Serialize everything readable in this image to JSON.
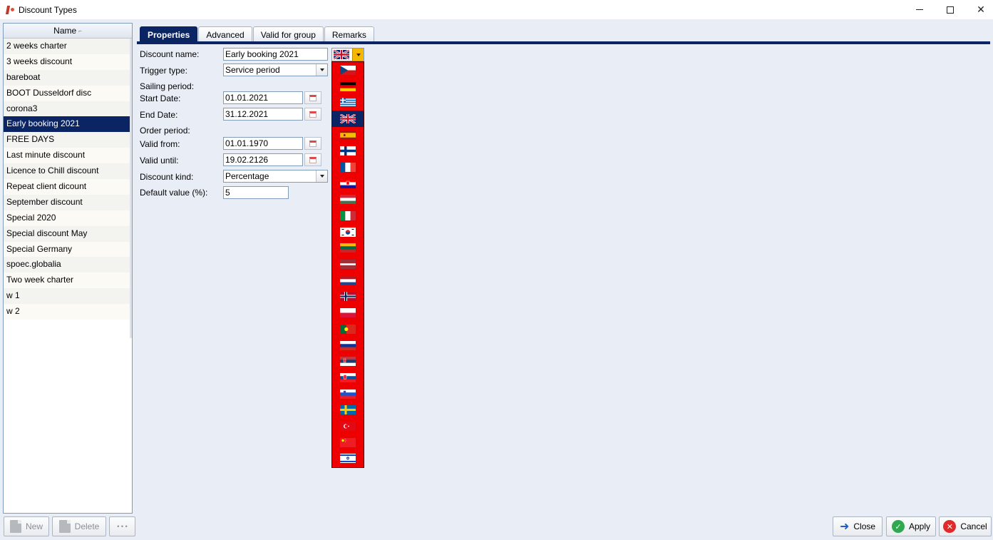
{
  "window": {
    "title": "Discount Types"
  },
  "list": {
    "header": "Name",
    "selected_index": 5,
    "items": [
      "2 weeks charter",
      "3 weeks discount",
      "bareboat",
      "BOOT Dusseldorf disc",
      "corona3",
      "Early booking 2021",
      "FREE DAYS",
      "Last minute discount",
      "Licence to Chill discount",
      "Repeat client dicount",
      "September discount",
      "Special 2020",
      "Special discount May",
      "Special Germany",
      "spoec.globalia",
      "Two week charter",
      "w 1",
      "w 2"
    ]
  },
  "left_buttons": {
    "new": "New",
    "delete": "Delete",
    "more": "• • •"
  },
  "tabs": [
    "Properties",
    "Advanced",
    "Valid for group",
    "Remarks"
  ],
  "form": {
    "discount_name_label": "Discount name:",
    "discount_name_value": "Early booking 2021",
    "trigger_type_label": "Trigger type:",
    "trigger_type_value": "Service period",
    "sailing_period_label": "Sailing period:",
    "start_date_label": "Start Date:",
    "start_date_value": "01.01.2021",
    "end_date_label": "End Date:",
    "end_date_value": "31.12.2021",
    "order_period_label": "Order period:",
    "valid_from_label": "Valid from:",
    "valid_from_value": "01.01.1970",
    "valid_until_label": "Valid until:",
    "valid_until_value": "19.02.2126",
    "discount_kind_label": "Discount kind:",
    "discount_kind_value": "Percentage",
    "default_value_label": "Default value (%):",
    "default_value_value": "5"
  },
  "language_selector": {
    "selected": "uk-flag-icon",
    "flags": [
      "czech-flag-icon",
      "german-flag-icon",
      "greek-flag-icon",
      "uk-flag-icon",
      "spanish-flag-icon",
      "finnish-flag-icon",
      "french-flag-icon",
      "croatian-flag-icon",
      "hungarian-flag-icon",
      "italian-flag-icon",
      "korean-flag-icon",
      "lithuanian-flag-icon",
      "latvian-flag-icon",
      "dutch-flag-icon",
      "norwegian-flag-icon",
      "polish-flag-icon",
      "portuguese-flag-icon",
      "russian-flag-icon",
      "serbian-flag-icon",
      "slovak-flag-icon",
      "slovenian-flag-icon",
      "swedish-flag-icon",
      "turkish-flag-icon",
      "chinese-flag-icon",
      "israeli-flag-icon"
    ]
  },
  "right_buttons": {
    "close": "Close",
    "apply": "Apply",
    "cancel": "Cancel"
  },
  "colors": {
    "selection": "#0a2464",
    "background": "#e9eef6",
    "flag_list_bg": "#ee0000"
  }
}
